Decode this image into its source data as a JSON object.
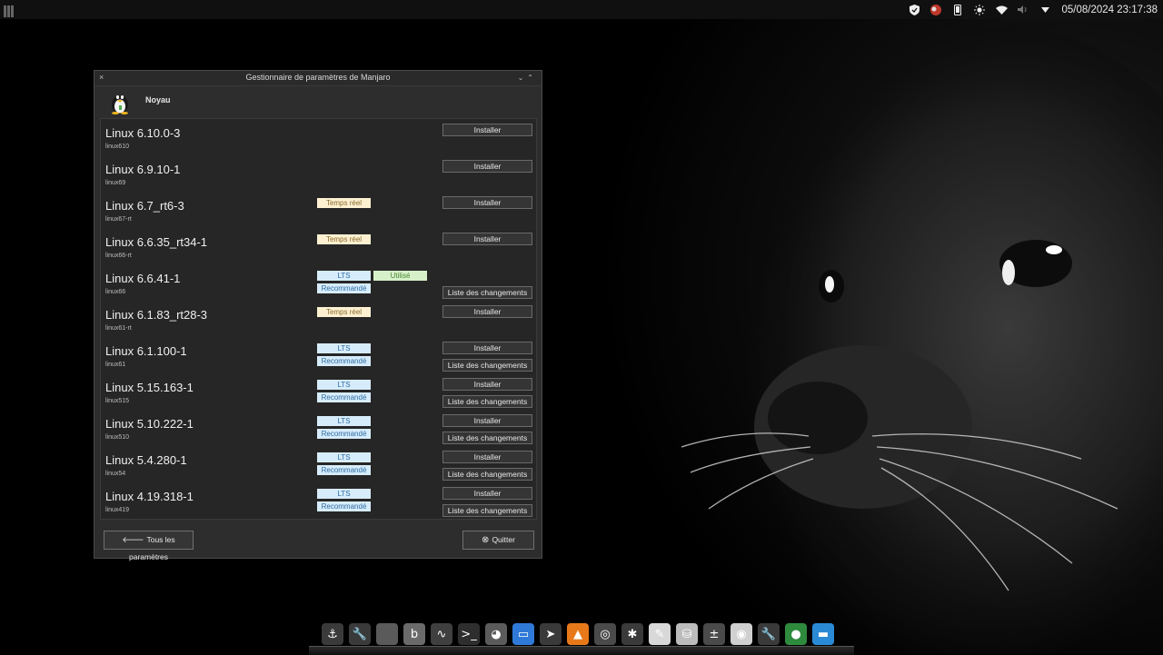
{
  "top_panel": {
    "clock": "05/08/2024 23:17:38",
    "tray_icons": [
      "shield-icon",
      "notification-badge-icon",
      "phone-icon",
      "brightness-icon",
      "wifi-icon",
      "volume-icon",
      "tray-expand-icon"
    ]
  },
  "window": {
    "title": "Gestionnaire de paramètres de Manjaro",
    "close_glyph": "×",
    "controls_glyph": "⌄⌃",
    "module_title": "Noyau",
    "kernels": [
      {
        "name": "Linux 6.10.0-3",
        "package": "linux610",
        "tags": [],
        "buttons": [
          "Installer"
        ]
      },
      {
        "name": "Linux 6.9.10-1",
        "package": "linux69",
        "tags": [],
        "buttons": [
          "Installer"
        ]
      },
      {
        "name": "Linux 6.7_rt6-3",
        "package": "linux67-rt",
        "tags": [
          "Temps réel"
        ],
        "buttons": [
          "Installer"
        ]
      },
      {
        "name": "Linux 6.6.35_rt34-1",
        "package": "linux66-rt",
        "tags": [
          "Temps réel"
        ],
        "buttons": [
          "Installer"
        ]
      },
      {
        "name": "Linux 6.6.41-1",
        "package": "linux66",
        "tags": [
          "LTS",
          "Recommandé",
          "Utilisé"
        ],
        "buttons": [
          "Liste des changements"
        ]
      },
      {
        "name": "Linux 6.1.83_rt28-3",
        "package": "linux61-rt",
        "tags": [
          "Temps réel"
        ],
        "buttons": [
          "Installer"
        ]
      },
      {
        "name": "Linux 6.1.100-1",
        "package": "linux61",
        "tags": [
          "LTS",
          "Recommandé"
        ],
        "buttons": [
          "Installer",
          "Liste des changements"
        ]
      },
      {
        "name": "Linux 5.15.163-1",
        "package": "linux515",
        "tags": [
          "LTS",
          "Recommandé"
        ],
        "buttons": [
          "Installer",
          "Liste des changements"
        ]
      },
      {
        "name": "Linux 5.10.222-1",
        "package": "linux510",
        "tags": [
          "LTS",
          "Recommandé"
        ],
        "buttons": [
          "Installer",
          "Liste des changements"
        ]
      },
      {
        "name": "Linux 5.4.280-1",
        "package": "linux54",
        "tags": [
          "LTS",
          "Recommandé"
        ],
        "buttons": [
          "Installer",
          "Liste des changements"
        ]
      },
      {
        "name": "Linux 4.19.318-1",
        "package": "linux419",
        "tags": [
          "LTS",
          "Recommandé"
        ],
        "buttons": [
          "Installer",
          "Liste des changements"
        ]
      }
    ],
    "back_button": "Tous les paramètres",
    "back_icon_glyph": "🡐",
    "quit_button": "Quitter",
    "quit_icon_glyph": "⊗"
  },
  "dock": {
    "items": [
      {
        "icon": "anchor-icon",
        "glyph": "⚓",
        "color": "#3a3a3a"
      },
      {
        "icon": "settings-tool-icon",
        "glyph": "🔧",
        "color": "#3a3a3a"
      },
      {
        "icon": "folder-icon",
        "glyph": "",
        "color": "#5a5a5a"
      },
      {
        "icon": "b-app-icon",
        "glyph": "b",
        "color": "#6a6a6a"
      },
      {
        "icon": "system-monitor-icon",
        "glyph": "∿",
        "color": "#3f3f3f"
      },
      {
        "icon": "terminal-icon",
        "glyph": ">_",
        "color": "#2e2e2e"
      },
      {
        "icon": "firefox-icon",
        "glyph": "◕",
        "color": "#5b5b5b"
      },
      {
        "icon": "file-manager-icon",
        "glyph": "▭",
        "color": "#2f7ad8"
      },
      {
        "icon": "cursor-icon",
        "glyph": "➤",
        "color": "#3a3a3a"
      },
      {
        "icon": "vlc-icon",
        "glyph": "▲",
        "color": "#e8791a"
      },
      {
        "icon": "disc-icon",
        "glyph": "◎",
        "color": "#4a4a4a"
      },
      {
        "icon": "kde-connect-icon",
        "glyph": "✱",
        "color": "#3a3a3a"
      },
      {
        "icon": "text-editor-icon",
        "glyph": "✎",
        "color": "#d8d8d8"
      },
      {
        "icon": "package-icon",
        "glyph": "⛁",
        "color": "#bcbcbc"
      },
      {
        "icon": "calculator-icon",
        "glyph": "±",
        "color": "#4a4a4a"
      },
      {
        "icon": "document-viewer-icon",
        "glyph": "◉",
        "color": "#d0d0d0"
      },
      {
        "icon": "settings-wrench-icon",
        "glyph": "🔧",
        "color": "#3a3a3a"
      },
      {
        "icon": "radar-icon",
        "glyph": "●",
        "color": "#2e8a3c"
      },
      {
        "icon": "desktop-icon",
        "glyph": "▬",
        "color": "#2a8ad6"
      }
    ]
  }
}
